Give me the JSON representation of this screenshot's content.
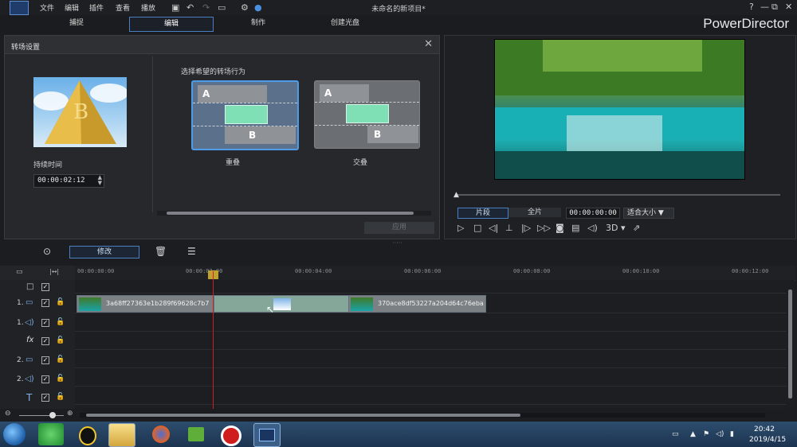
{
  "menu": [
    "文件",
    "编辑",
    "插件",
    "查看",
    "播放"
  ],
  "document_title": "未命名的新项目*",
  "window_buttons": [
    "?",
    "—",
    "⧉",
    "✕"
  ],
  "mode_tabs": [
    "捕捉",
    "编辑",
    "制作",
    "创建光盘"
  ],
  "active_tab": "编辑",
  "brand": "PowerDirector",
  "transition_panel": {
    "title": "转场设置",
    "close": "✕",
    "duration_label": "持续时间",
    "duration_value": "00:00:02:12",
    "choose_label": "选择希望的转场行为",
    "options": [
      {
        "label": "重叠",
        "clip_a": "A",
        "clip_b": "B",
        "selected": true
      },
      {
        "label": "交叠",
        "clip_a": "A",
        "clip_b": "B",
        "selected": false
      }
    ],
    "ok_label": "应用"
  },
  "player": {
    "clip_tab": "片段",
    "movie_tab": "全片",
    "timecode": "00:00:00:00",
    "fit_label": "适合大小",
    "mode_3d": "3D"
  },
  "toolbar": {
    "modify_label": "修改"
  },
  "ruler_ticks": [
    "00:00:00:00",
    "00:00:02:00",
    "00:00:04:00",
    "00:00:06:00",
    "00:00:08:00",
    "00:00:10:00",
    "00:00:12:00"
  ],
  "tracks": [
    {
      "num": "",
      "icon": "□"
    },
    {
      "num": "1.",
      "icon": "▭"
    },
    {
      "num": "1.",
      "icon": "◁)"
    },
    {
      "num": "",
      "icon": "fx"
    },
    {
      "num": "2.",
      "icon": "▭"
    },
    {
      "num": "2.",
      "icon": "◁)"
    },
    {
      "num": "",
      "icon": "T"
    }
  ],
  "clips": {
    "clip1": "3a68ff27363e1b289f69628c7b7",
    "clip2": "370ace8df53227a204d64c76eba"
  },
  "taskbar": {
    "time": "20:42",
    "date": "2019/4/15"
  }
}
